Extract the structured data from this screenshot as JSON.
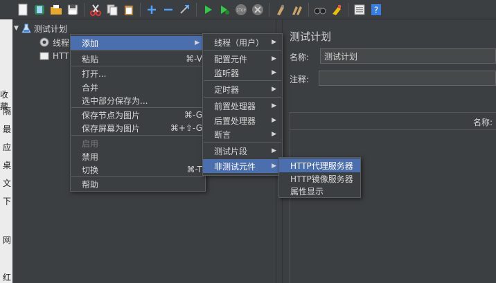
{
  "toolbar": {
    "icons": [
      "new-icon",
      "templates-icon",
      "open-icon",
      "save-icon",
      "cut-icon",
      "copy-icon",
      "paste-icon",
      "expand-icon",
      "collapse-icon",
      "toggle-icon",
      "start-icon",
      "start-no-pause-icon",
      "stop-icon",
      "shutdown-icon",
      "clear-icon",
      "clear-all-icon",
      "search-icon",
      "reset-search-icon",
      "function-helper-icon",
      "help-icon"
    ]
  },
  "bg_window": {
    "chars": [
      "收藏",
      "隔",
      "最",
      "应",
      "桌",
      "文",
      "下",
      "网",
      "红"
    ]
  },
  "tree": {
    "root_label": "测试计划",
    "child1_label": "线程",
    "child2_label": "HTT"
  },
  "right_panel": {
    "title": "测试计划",
    "name_label": "名称:",
    "name_value": "测试计划",
    "comment_label": "注释:",
    "table_header": "名称:"
  },
  "context_menu": {
    "items": [
      {
        "label": "添加",
        "shortcut": "",
        "submenu": true
      },
      {
        "label": "粘贴",
        "shortcut": "⌘-V"
      },
      {
        "label": "打开...",
        "shortcut": ""
      },
      {
        "label": "合并",
        "shortcut": ""
      },
      {
        "label": "选中部分保存为...",
        "shortcut": ""
      },
      {
        "label": "保存节点为图片",
        "shortcut": "⌘-G"
      },
      {
        "label": "保存屏幕为图片",
        "shortcut": "⌘+⇧-G"
      },
      {
        "label": "启用",
        "shortcut": ""
      },
      {
        "label": "禁用",
        "shortcut": ""
      },
      {
        "label": "切换",
        "shortcut": "⌘-T"
      },
      {
        "label": "帮助",
        "shortcut": ""
      }
    ]
  },
  "add_menu": {
    "items": [
      {
        "label": "线程（用户）"
      },
      {
        "label": "配置元件"
      },
      {
        "label": "监听器"
      },
      {
        "label": "定时器"
      },
      {
        "label": "前置处理器"
      },
      {
        "label": "后置处理器"
      },
      {
        "label": "断言"
      },
      {
        "label": "测试片段"
      },
      {
        "label": "非测试元件"
      }
    ]
  },
  "non_test_menu": {
    "items": [
      {
        "label": "HTTP代理服务器"
      },
      {
        "label": "HTTP镜像服务器"
      },
      {
        "label": "属性显示"
      }
    ]
  },
  "colors": {
    "background": "#3c3f41",
    "highlight": "#4b6eaf",
    "text": "#d6d6d6",
    "disabled": "#7a7a7a"
  }
}
